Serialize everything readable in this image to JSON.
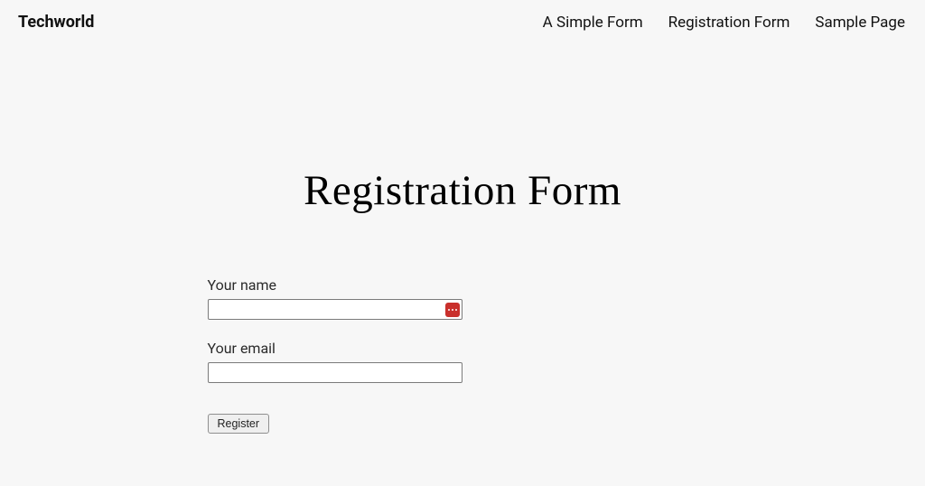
{
  "header": {
    "brand": "Techworld",
    "nav": [
      {
        "label": "A Simple Form"
      },
      {
        "label": "Registration Form"
      },
      {
        "label": "Sample Page"
      }
    ]
  },
  "main": {
    "title": "Registration Form",
    "form": {
      "name_label": "Your name",
      "name_value": "",
      "email_label": "Your email",
      "email_value": "",
      "submit_label": "Register"
    }
  },
  "icons": {
    "password_manager": "password-manager-icon"
  }
}
